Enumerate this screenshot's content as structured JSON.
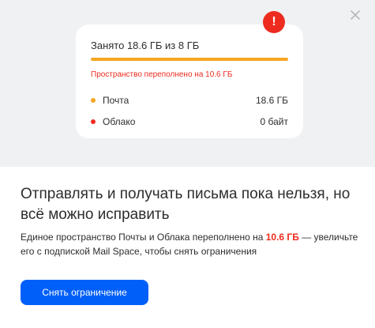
{
  "modal": {
    "close_icon": "close-icon",
    "alert_icon": "exclamation-icon",
    "alert_symbol": "!",
    "storage": {
      "title": "Занято 18.6 ГБ из 8 ГБ",
      "usage_fraction": 1.0,
      "overflow_text": "Пространство переполнено на 10.6 ГБ",
      "items": [
        {
          "label": "Почта",
          "value": "18.6 ГБ",
          "color": "#f5a623"
        },
        {
          "label": "Облако",
          "value": "0 байт",
          "color": "#ed2c1f"
        }
      ]
    },
    "headline": "Отправлять и получать письма пока нельзя, но всё можно исправить",
    "description": {
      "before": "Единое пространство Почты и Облака переполнено на ",
      "highlight": "10.6 ГБ",
      "after": " — увеличьте его с подпиской Mail Space, чтобы снять ограничения"
    },
    "cta_label": "Снять ограничение"
  },
  "colors": {
    "top_background": "#f0f1f3",
    "accent_blue": "#005ff9",
    "alert_red": "#ed2c1f",
    "bar_orange": "#f5a623"
  }
}
